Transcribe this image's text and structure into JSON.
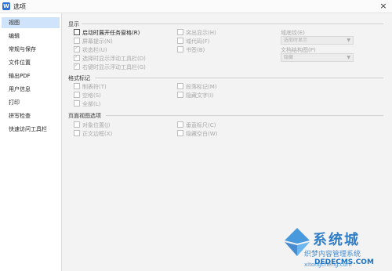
{
  "window": {
    "title": "选项",
    "app_icon_label": "W",
    "close_label": "×"
  },
  "sidebar": {
    "items": [
      {
        "label": "视图",
        "active": true
      },
      {
        "label": "编辑"
      },
      {
        "label": "常规与保存"
      },
      {
        "label": "文件位置"
      },
      {
        "label": "输出PDF"
      },
      {
        "label": "用户信息"
      },
      {
        "label": "打印"
      },
      {
        "label": "拼写检查"
      },
      {
        "label": "快速访问工具栏"
      }
    ]
  },
  "display": {
    "title": "显示",
    "options": [
      {
        "label": "启动时展开任务窗格(R)",
        "checked": false,
        "enabled": true
      },
      {
        "label": "屏幕提示(N)",
        "checked": false,
        "enabled": false
      },
      {
        "label": "状态栏(U)",
        "checked": true,
        "enabled": false
      },
      {
        "label": "选择时显示浮动工具栏(D)",
        "checked": true,
        "enabled": false
      },
      {
        "label": "右键时显示浮动工具栏(G)",
        "checked": true,
        "enabled": false
      }
    ],
    "options_col2": [
      {
        "label": "突出显示(H)",
        "checked": false,
        "enabled": false
      },
      {
        "label": "域代码(F)",
        "checked": false,
        "enabled": false
      },
      {
        "label": "书签(B)",
        "checked": false,
        "enabled": false
      }
    ],
    "field_shading_label": "域底纹(E)",
    "field_shading_value": "选取时显示",
    "doc_map_label": "文档结构图(P)",
    "doc_map_value": "隐藏"
  },
  "format_marks": {
    "title": "格式标记",
    "options": [
      {
        "label": "制表符(T)",
        "checked": false
      },
      {
        "label": "空格(S)",
        "checked": false
      },
      {
        "label": "全部(L)",
        "checked": false
      }
    ],
    "options_col2": [
      {
        "label": "段落标记(M)",
        "checked": false
      },
      {
        "label": "隐藏文字(I)",
        "checked": false
      }
    ]
  },
  "page_view": {
    "title": "页面视图选项",
    "options": [
      {
        "label": "对象位置(J)",
        "checked": false
      },
      {
        "label": "正文边框(X)",
        "checked": false
      }
    ],
    "options_col2": [
      {
        "label": "垂直标尺(C)",
        "checked": false
      },
      {
        "label": "隐藏空白(W)",
        "checked": false
      }
    ]
  },
  "watermark": {
    "brand": "系统城",
    "line1": "织梦内容管理系统",
    "line2": "DEDECMS.COM",
    "line3": "xitongcheng.com"
  },
  "colors": {
    "accent": "#cfe4fb",
    "brand": "#1b72c4"
  }
}
